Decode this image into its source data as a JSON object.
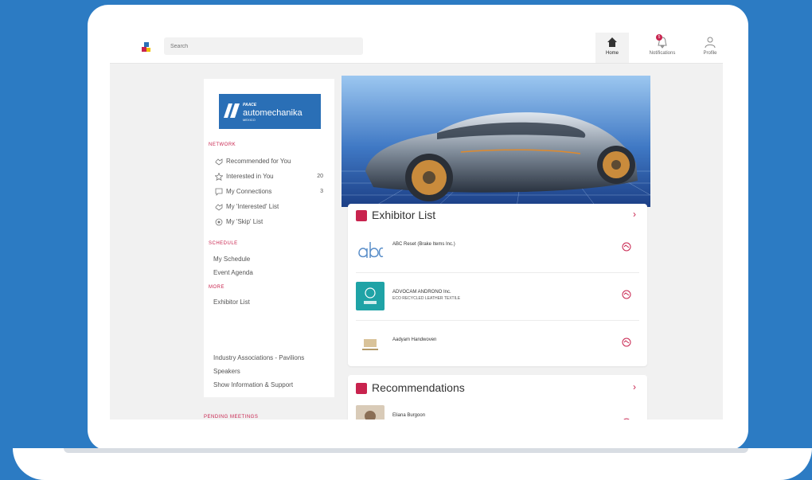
{
  "topbar": {
    "search_placeholder": "Search",
    "nav": [
      {
        "label": "Home",
        "icon": "home-icon"
      },
      {
        "label": "Notifications",
        "icon": "bell-icon",
        "badge": "5"
      },
      {
        "label": "Profile",
        "icon": "user-icon"
      }
    ]
  },
  "sidebar": {
    "brand": {
      "top": "PAACE",
      "main": "automechanika",
      "sub": "MEXICO"
    },
    "network_heading": "NETWORK",
    "network_items": [
      {
        "label": "Recommended for You",
        "icon": "handshake-icon",
        "count": ""
      },
      {
        "label": "Interested in You",
        "icon": "star-icon",
        "count": "20"
      },
      {
        "label": "My Connections",
        "icon": "chat-icon",
        "count": "3"
      },
      {
        "label": "My 'Interested' List",
        "icon": "handshake-icon",
        "count": ""
      },
      {
        "label": "My 'Skip' List",
        "icon": "skip-icon",
        "count": ""
      }
    ],
    "schedule_heading": "SCHEDULE",
    "schedule_items": [
      "My Schedule",
      "Event Agenda"
    ],
    "more_heading": "MORE",
    "more_items": [
      "Exhibitor List",
      "Industry Associations - Pavilions",
      "Speakers",
      "Show Information & Support"
    ],
    "below_heading": "PENDING MEETINGS"
  },
  "exhibitors": {
    "title": "Exhibitor List",
    "items": [
      {
        "name": "ABC Reset (Brake Items Inc.)",
        "sub": ""
      },
      {
        "name": "ADVOCAM ANDRONO Inc.",
        "sub": "ECO RECYCLED LEATHER TEXTILE"
      },
      {
        "name": "Aadyam Handwoven",
        "sub": ""
      }
    ]
  },
  "recommendations": {
    "title": "Recommendations",
    "items": [
      {
        "name": "Eliana Burgoon"
      }
    ]
  },
  "colors": {
    "accent": "#c8234e",
    "background": "#2c7bc3",
    "brand_blue": "#2a6fb6"
  }
}
